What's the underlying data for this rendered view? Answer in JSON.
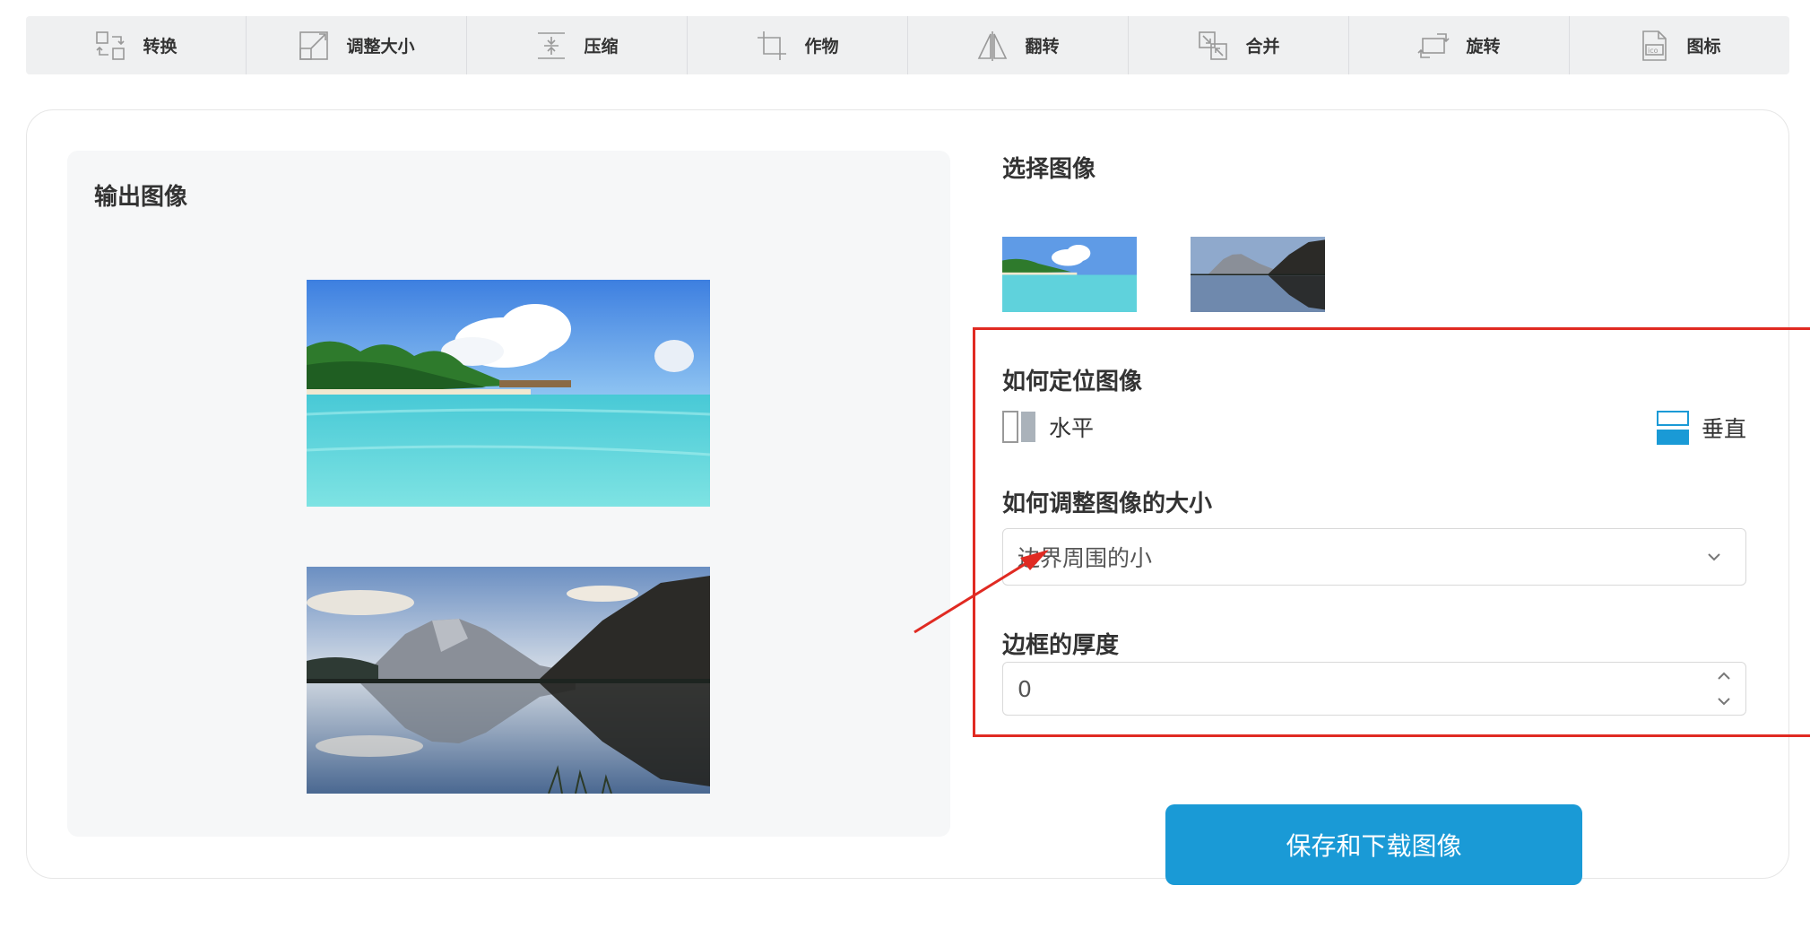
{
  "toolbar": {
    "items": [
      {
        "label": "转换",
        "icon": "convert-icon"
      },
      {
        "label": "调整大小",
        "icon": "resize-icon"
      },
      {
        "label": "压缩",
        "icon": "compress-icon"
      },
      {
        "label": "作物",
        "icon": "crop-icon"
      },
      {
        "label": "翻转",
        "icon": "flip-icon"
      },
      {
        "label": "合并",
        "icon": "merge-icon"
      },
      {
        "label": "旋转",
        "icon": "rotate-icon"
      },
      {
        "label": "图标",
        "icon": "ico-file-icon"
      }
    ]
  },
  "output": {
    "title": "输出图像",
    "images": [
      "beach-image",
      "mountain-lake-image"
    ]
  },
  "settings": {
    "select_title": "选择图像",
    "position_title": "如何定位图像",
    "orientation": {
      "horizontal_label": "水平",
      "vertical_label": "垂直",
      "selected": "vertical"
    },
    "resize_title": "如何调整图像的大小",
    "resize_value": "边界周围的小",
    "border_title": "边框的厚度",
    "border_value": "0"
  },
  "save_button": "保存和下载图像",
  "colors": {
    "accent": "#1a9ad6",
    "annotation": "#e02a22",
    "toolbar_bg": "#eff0f1"
  }
}
